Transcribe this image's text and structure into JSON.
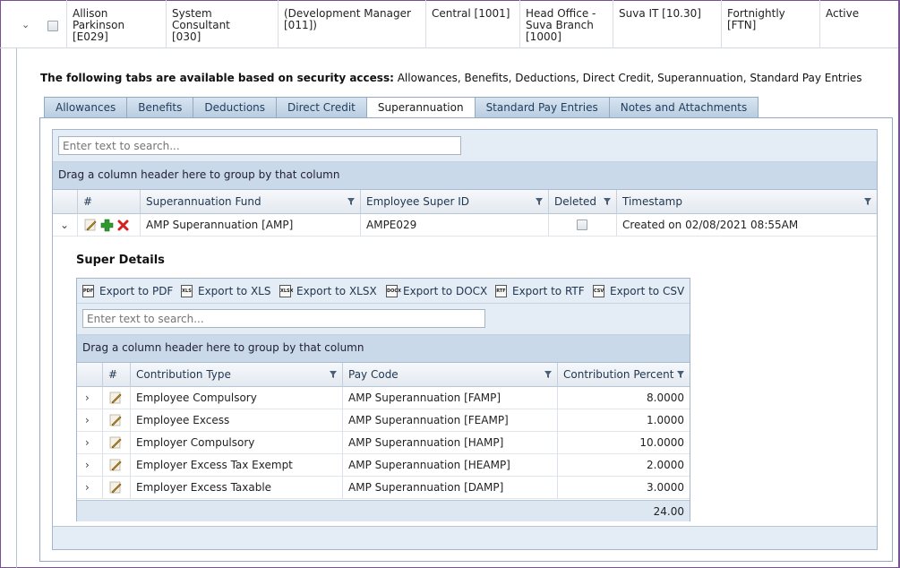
{
  "employee_row": {
    "name": "Allison\nParkinson\n[E029]",
    "position": "System Consultant\n[030]",
    "reports_to": "(Development Manager\n[011])",
    "region": "Central [1001]",
    "location": "Head Office -\nSuva Branch\n[1000]",
    "department": "Suva IT [10.30]",
    "pay_frequency": "Fortnightly [FTN]",
    "status": "Active"
  },
  "access": {
    "prefix": "The following tabs are available based on security access:",
    "list": " Allowances, Benefits, Deductions, Direct Credit, Superannuation, Standard Pay Entries"
  },
  "tabs": [
    {
      "label": "Allowances",
      "active": false
    },
    {
      "label": "Benefits",
      "active": false
    },
    {
      "label": "Deductions",
      "active": false
    },
    {
      "label": "Direct Credit",
      "active": false
    },
    {
      "label": "Superannuation",
      "active": true
    },
    {
      "label": "Standard Pay Entries",
      "active": false
    },
    {
      "label": "Notes and Attachments",
      "active": false
    }
  ],
  "super_grid": {
    "search_placeholder": "Enter text to search...",
    "group_hint": "Drag a column header here to group by that column",
    "columns": {
      "num": "#",
      "fund": "Superannuation Fund",
      "super_id": "Employee Super ID",
      "deleted": "Deleted",
      "timestamp": "Timestamp"
    },
    "row": {
      "fund": "AMP Superannuation [AMP]",
      "super_id": "AMPE029",
      "timestamp": "Created on 02/08/2021 08:55AM"
    }
  },
  "details": {
    "title": "Super Details",
    "exports": [
      "Export to PDF",
      "Export to XLS",
      "Export to XLSX",
      "Export to DOCX",
      "Export to RTF",
      "Export to CSV"
    ],
    "export_icons": [
      "PDF",
      "XLS",
      "XLSX",
      "DOCX",
      "RTF",
      "CSV"
    ],
    "search_placeholder": "Enter text to search...",
    "group_hint": "Drag a column header here to group by that column",
    "columns": {
      "num": "#",
      "type": "Contribution Type",
      "pay_code": "Pay Code",
      "percent": "Contribution Percent"
    },
    "rows": [
      {
        "type": "Employee Compulsory",
        "pay_code": "AMP Superannuation [FAMP]",
        "percent": "8.0000"
      },
      {
        "type": "Employee Excess",
        "pay_code": "AMP Superannuation [FEAMP]",
        "percent": "1.0000"
      },
      {
        "type": "Employer Compulsory",
        "pay_code": "AMP Superannuation [HAMP]",
        "percent": "10.0000"
      },
      {
        "type": "Employer Excess Tax Exempt",
        "pay_code": "AMP Superannuation [HEAMP]",
        "percent": "2.0000"
      },
      {
        "type": "Employer Excess Taxable",
        "pay_code": "AMP Superannuation [DAMP]",
        "percent": "3.0000"
      }
    ],
    "total": "24.00"
  },
  "icons": {
    "expand": "chevron-right-icon",
    "collapse": "chevron-down-icon",
    "edit": "pencil-icon",
    "add": "plus-icon",
    "delete": "x-icon",
    "filter": "filter-icon"
  },
  "colors": {
    "tab_bg": "#b9cde1",
    "panel_bg": "#e4ecf5",
    "group_bg": "#c9d9ea",
    "frame": "#7a4f9a",
    "add_green": "#2e9a2e",
    "delete_red": "#d42020"
  }
}
